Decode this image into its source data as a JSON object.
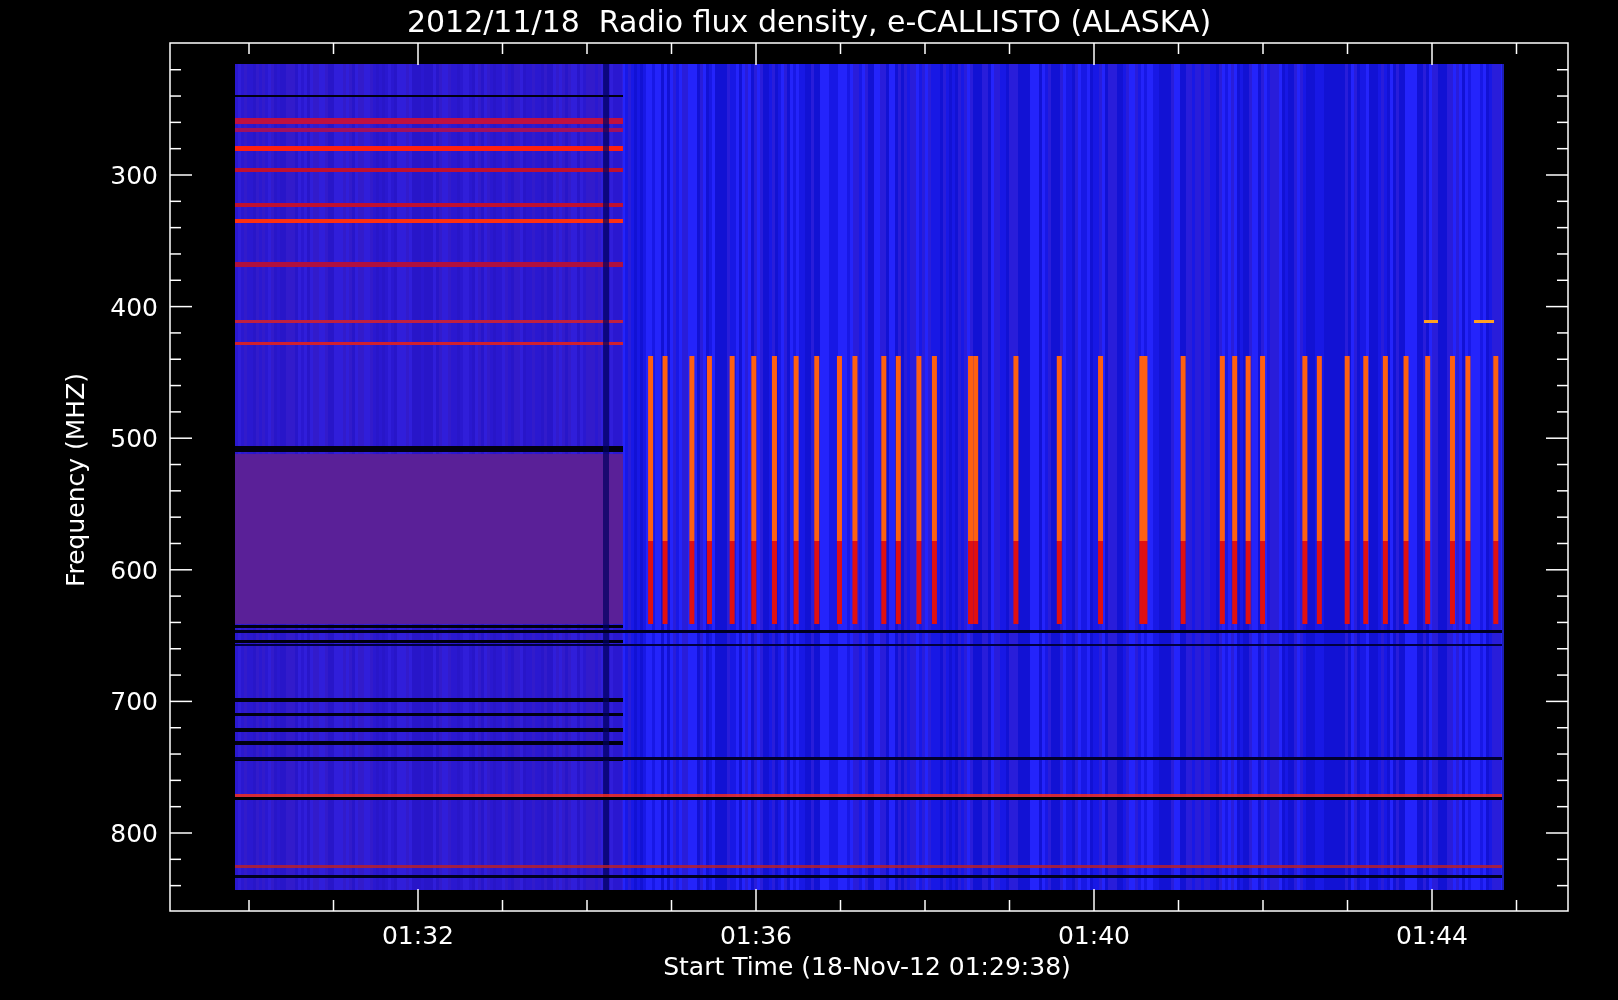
{
  "title": "2012/11/18  Radio flux density, e-CALLISTO (ALASKA)",
  "y_axis": {
    "label": "Frequency (MHZ)",
    "tick_labels": [
      "300",
      "400",
      "500",
      "600",
      "700",
      "800"
    ]
  },
  "x_axis": {
    "label": "Start Time (18-Nov-12 01:29:38)",
    "tick_labels": [
      "01:32",
      "01:36",
      "01:40",
      "01:44"
    ]
  }
}
